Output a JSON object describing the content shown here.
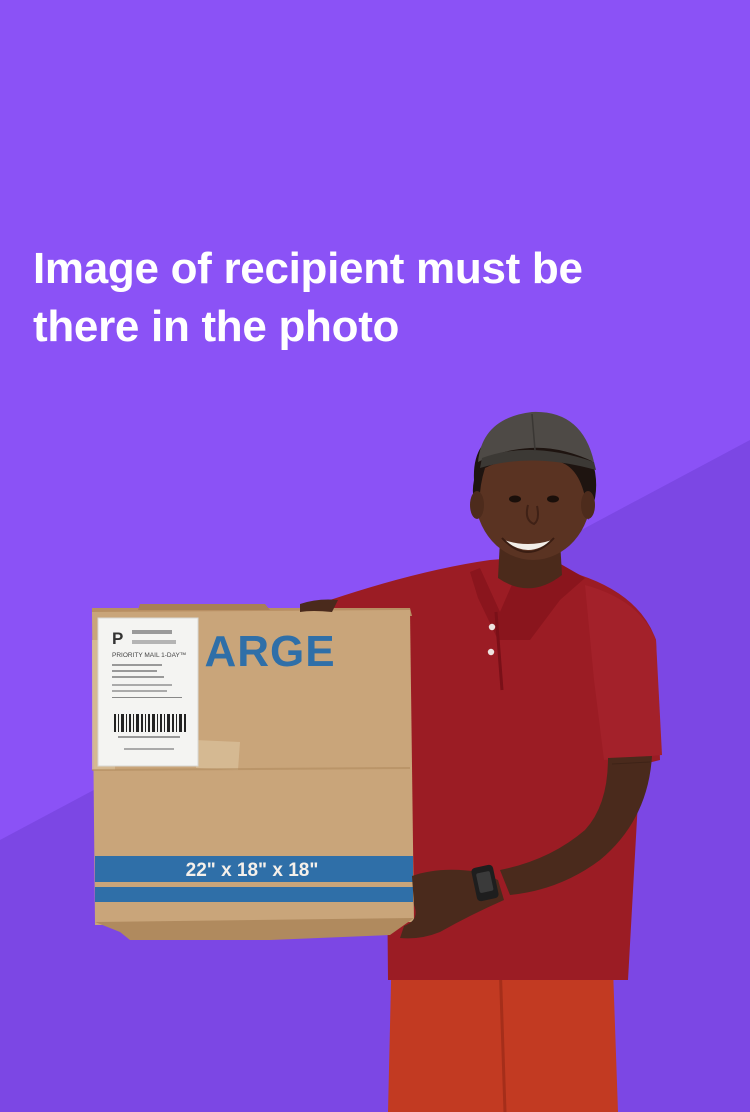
{
  "headline": {
    "line1": "Image of recipient must be",
    "line2": "there in the photo"
  },
  "photo": {
    "box_brand_text": "ARGE",
    "box_dimensions_text": "22\" x 18\" x 18\"",
    "shipping_label_letter": "P",
    "shipping_label_service": "PRIORITY MAIL 1-DAY™"
  },
  "colors": {
    "background": "#8B52F6",
    "background_shade": "#7A45DF",
    "headline_text": "#FFFFFF",
    "box_brand_blue": "#2F6FA8",
    "shirt": "#9B1C24",
    "pants": "#C23A22",
    "cardboard": "#C9A57A"
  },
  "icons": {
    "recipient_photo": "delivery-person-holding-box-photo"
  }
}
